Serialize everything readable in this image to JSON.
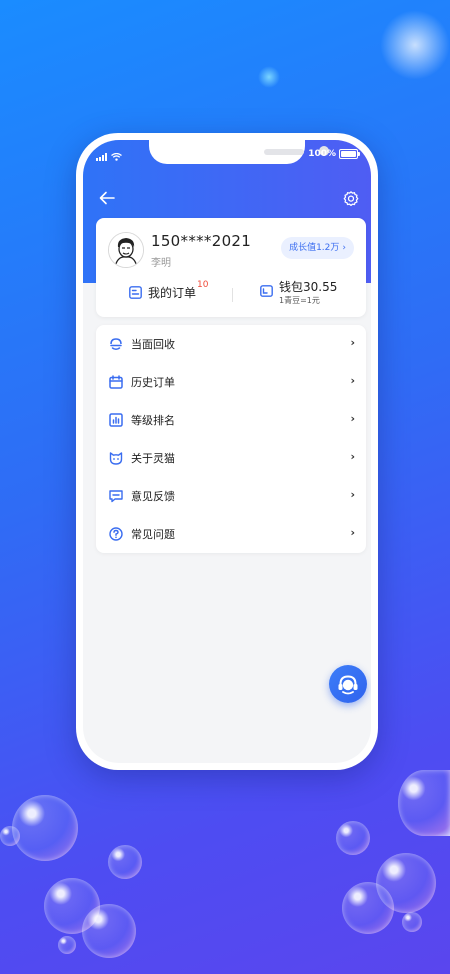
{
  "status_bar": {
    "battery": "100%"
  },
  "profile": {
    "phone": "150****2021",
    "name": "李明",
    "growth_label": "成长值1.2万",
    "growth_chevron": "›"
  },
  "orders": {
    "label": "我的订单",
    "badge": "10"
  },
  "wallet": {
    "label": "钱包30.55",
    "sub": "1青豆=1元"
  },
  "menu": {
    "items": [
      {
        "label": "当面回收",
        "icon": "recycle-icon"
      },
      {
        "label": "历史订单",
        "icon": "calendar-icon"
      },
      {
        "label": "等级排名",
        "icon": "bar-chart-icon"
      },
      {
        "label": "关于灵猫",
        "icon": "cat-icon"
      },
      {
        "label": "意见反馈",
        "icon": "feedback-icon"
      },
      {
        "label": "常见问题",
        "icon": "question-icon"
      }
    ],
    "chevron": "›"
  },
  "colors": {
    "accent": "#3a6df0",
    "badge": "#f04b3a",
    "header_start": "#2f73f7",
    "header_end": "#4f5df3"
  },
  "icons": {
    "back": "back-arrow-icon",
    "settings": "gear-icon",
    "customer_service": "headset-icon"
  }
}
